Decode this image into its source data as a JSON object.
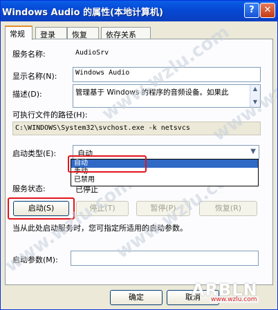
{
  "window": {
    "title": "Windows Audio 的属性(本地计算机)"
  },
  "titlebar_buttons": {
    "help": "?",
    "close": "✕"
  },
  "tabs": [
    {
      "label": "常规",
      "active": true
    },
    {
      "label": "登录"
    },
    {
      "label": "恢复"
    },
    {
      "label": "依存关系"
    }
  ],
  "form": {
    "service_name_label": "服务名称:",
    "service_name_value": "AudioSrv",
    "display_name_label": "显示名称(N):",
    "display_name_value": "Windows Audio",
    "description_label": "描述(D):",
    "description_value": "管理基于 Windows 的程序的音频设备。如果此",
    "exe_path_label": "可执行文件的路径(H):",
    "exe_path_value": "C:\\WINDOWS\\System32\\svchost.exe -k netsvcs",
    "startup_type_label": "启动类型(E):",
    "startup_type_value": "自动",
    "startup_options": [
      "自动",
      "手动",
      "已禁用"
    ],
    "service_status_label": "服务状态:",
    "service_status_value": "已停止",
    "hint": "当从此处启动服务时，您可指定所适用的启动参数。",
    "start_params_label": "启动参数(M):",
    "start_params_value": ""
  },
  "service_buttons": {
    "start": "启动(S)",
    "stop": "停止(T)",
    "pause": "暂停(P)",
    "resume": "恢复(R)"
  },
  "dialog_buttons": {
    "ok": "确定",
    "cancel": "取消"
  },
  "watermarks": {
    "text": "www.wzlu.com",
    "logo": "ARBLN",
    "site": "www.wzlu.com"
  },
  "colors": {
    "titlebar": "#0648d3",
    "highlight_box": "#e2141a",
    "selection": "#316ac5",
    "tab_accent": "#e68b2c"
  }
}
